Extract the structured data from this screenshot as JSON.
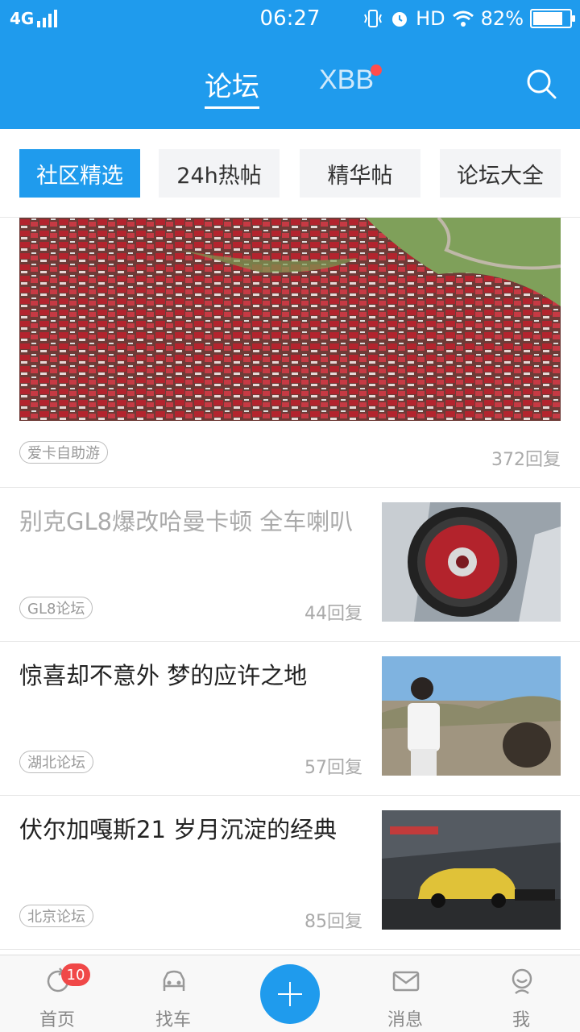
{
  "status_bar": {
    "network": "4G",
    "time": "06:27",
    "hd": "HD",
    "battery": "82%",
    "battery_level": 0.82
  },
  "header": {
    "tabs": [
      {
        "label": "论坛"
      },
      {
        "label": "XBB"
      }
    ],
    "search_icon": "search-icon"
  },
  "subtabs": [
    {
      "label": "社区精选"
    },
    {
      "label": "24h热帖"
    },
    {
      "label": "精华帖"
    },
    {
      "label": "论坛大全"
    }
  ],
  "feed": {
    "featured": {
      "tag": "爱卡自助游",
      "replies": "372回复"
    },
    "posts": [
      {
        "title": "别克GL8爆改哈曼卡顿 全车喇叭",
        "tag": "GL8论坛",
        "replies": "44回复"
      },
      {
        "title": "惊喜却不意外 梦的应许之地",
        "tag": "湖北论坛",
        "replies": "57回复"
      },
      {
        "title": "伏尔加嘎斯21 岁月沉淀的经典",
        "tag": "北京论坛",
        "replies": "85回复"
      }
    ]
  },
  "bottom_nav": {
    "items": [
      {
        "label": "首页",
        "badge": "10",
        "icon": "refresh-icon"
      },
      {
        "label": "找车",
        "icon": "car-icon"
      },
      {
        "label": "消息",
        "icon": "mail-icon"
      },
      {
        "label": "我",
        "icon": "profile-icon"
      }
    ],
    "add_icon": "plus-icon"
  },
  "colors": {
    "accent": "#1f9bed",
    "badge": "#f04848",
    "xbb_dot": "#ff4d4d"
  }
}
